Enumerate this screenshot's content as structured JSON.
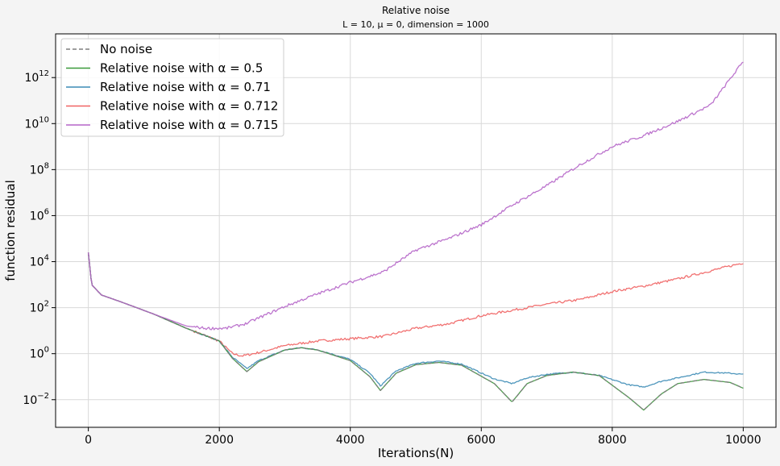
{
  "chart_data": {
    "type": "line",
    "title": "Relative noise",
    "subtitle": "L = 10, μ = 0, dimension = 1000",
    "xlabel": "Iterations(N)",
    "ylabel": "function residual",
    "xlim": [
      -500,
      10500
    ],
    "ylim_log10": [
      -3.2,
      13.9
    ],
    "yscale": "log",
    "xticks": [
      0,
      2000,
      4000,
      6000,
      8000,
      10000
    ],
    "xtick_labels": [
      "0",
      "2000",
      "4000",
      "6000",
      "8000",
      "10000"
    ],
    "yticks": [
      -2,
      0,
      2,
      4,
      6,
      8,
      10,
      12
    ],
    "ytick_labels": [
      "10",
      "10",
      "10",
      "10",
      "10",
      "10",
      "10",
      "10"
    ],
    "ytick_exponents": [
      "−2",
      "0",
      "2",
      "4",
      "6",
      "8",
      "10",
      "12"
    ],
    "grid": true,
    "legend_position": "upper-left",
    "series": [
      {
        "name": "No noise",
        "color": "#7f7f7f",
        "dash": "dashed",
        "points": [
          [
            0,
            4.4
          ],
          [
            50,
            3.0
          ],
          [
            200,
            2.55
          ],
          [
            500,
            2.25
          ],
          [
            1000,
            1.72
          ],
          [
            1500,
            1.1
          ],
          [
            2000,
            0.55
          ],
          [
            2200,
            -0.2
          ],
          [
            2420,
            -0.78
          ],
          [
            2600,
            -0.35
          ],
          [
            3000,
            0.16
          ],
          [
            3250,
            0.26
          ],
          [
            3500,
            0.16
          ],
          [
            4000,
            -0.3
          ],
          [
            4300,
            -1.0
          ],
          [
            4460,
            -1.6
          ],
          [
            4700,
            -0.85
          ],
          [
            5000,
            -0.48
          ],
          [
            5350,
            -0.38
          ],
          [
            5700,
            -0.5
          ],
          [
            6200,
            -1.3
          ],
          [
            6470,
            -2.1
          ],
          [
            6700,
            -1.3
          ],
          [
            7000,
            -0.95
          ],
          [
            7400,
            -0.8
          ],
          [
            7800,
            -0.95
          ],
          [
            8250,
            -1.9
          ],
          [
            8480,
            -2.45
          ],
          [
            8750,
            -1.75
          ],
          [
            9000,
            -1.3
          ],
          [
            9400,
            -1.12
          ],
          [
            9800,
            -1.25
          ],
          [
            10000,
            -1.5
          ]
        ]
      },
      {
        "name": "Relative noise with α = 0.5",
        "color": "#3a9a3a",
        "dash": "solid",
        "points": [
          [
            0,
            4.4
          ],
          [
            50,
            3.0
          ],
          [
            200,
            2.55
          ],
          [
            500,
            2.25
          ],
          [
            1000,
            1.72
          ],
          [
            1500,
            1.1
          ],
          [
            2000,
            0.55
          ],
          [
            2200,
            -0.2
          ],
          [
            2420,
            -0.78
          ],
          [
            2600,
            -0.35
          ],
          [
            3000,
            0.16
          ],
          [
            3250,
            0.26
          ],
          [
            3500,
            0.16
          ],
          [
            4000,
            -0.3
          ],
          [
            4300,
            -1.0
          ],
          [
            4460,
            -1.6
          ],
          [
            4700,
            -0.85
          ],
          [
            5000,
            -0.48
          ],
          [
            5350,
            -0.38
          ],
          [
            5700,
            -0.5
          ],
          [
            6200,
            -1.3
          ],
          [
            6470,
            -2.1
          ],
          [
            6700,
            -1.3
          ],
          [
            7000,
            -0.95
          ],
          [
            7400,
            -0.8
          ],
          [
            7800,
            -0.95
          ],
          [
            8250,
            -1.9
          ],
          [
            8480,
            -2.45
          ],
          [
            8750,
            -1.75
          ],
          [
            9000,
            -1.3
          ],
          [
            9400,
            -1.12
          ],
          [
            9800,
            -1.25
          ],
          [
            10000,
            -1.5
          ]
        ]
      },
      {
        "name": "Relative noise with α = 0.71",
        "color": "#3b8bb5",
        "dash": "solid",
        "points": [
          [
            0,
            4.4
          ],
          [
            50,
            3.0
          ],
          [
            200,
            2.55
          ],
          [
            500,
            2.25
          ],
          [
            1000,
            1.72
          ],
          [
            1500,
            1.1
          ],
          [
            2000,
            0.55
          ],
          [
            2200,
            -0.15
          ],
          [
            2420,
            -0.65
          ],
          [
            2600,
            -0.3
          ],
          [
            3000,
            0.16
          ],
          [
            3250,
            0.26
          ],
          [
            3500,
            0.17
          ],
          [
            4000,
            -0.25
          ],
          [
            4300,
            -0.85
          ],
          [
            4460,
            -1.4
          ],
          [
            4700,
            -0.75
          ],
          [
            5000,
            -0.42
          ],
          [
            5350,
            -0.32
          ],
          [
            5700,
            -0.45
          ],
          [
            6200,
            -1.1
          ],
          [
            6470,
            -1.3
          ],
          [
            6700,
            -1.05
          ],
          [
            7000,
            -0.9
          ],
          [
            7400,
            -0.8
          ],
          [
            7800,
            -0.95
          ],
          [
            8250,
            -1.35
          ],
          [
            8480,
            -1.45
          ],
          [
            8750,
            -1.2
          ],
          [
            9000,
            -1.05
          ],
          [
            9400,
            -0.8
          ],
          [
            9800,
            -0.85
          ],
          [
            10000,
            -0.9
          ]
        ]
      },
      {
        "name": "Relative noise with α = 0.712",
        "color": "#f06262",
        "dash": "solid",
        "points": [
          [
            0,
            4.4
          ],
          [
            50,
            3.0
          ],
          [
            200,
            2.55
          ],
          [
            500,
            2.25
          ],
          [
            1000,
            1.72
          ],
          [
            1500,
            1.1
          ],
          [
            2000,
            0.55
          ],
          [
            2200,
            0.0
          ],
          [
            2350,
            -0.1
          ],
          [
            2600,
            0.05
          ],
          [
            3000,
            0.35
          ],
          [
            3500,
            0.55
          ],
          [
            4000,
            0.65
          ],
          [
            4500,
            0.75
          ],
          [
            5000,
            1.1
          ],
          [
            5500,
            1.3
          ],
          [
            6000,
            1.65
          ],
          [
            6500,
            1.9
          ],
          [
            7000,
            2.15
          ],
          [
            7500,
            2.35
          ],
          [
            8000,
            2.7
          ],
          [
            8500,
            2.95
          ],
          [
            9000,
            3.25
          ],
          [
            9500,
            3.6
          ],
          [
            10000,
            3.95
          ]
        ]
      },
      {
        "name": "Relative noise with α = 0.715",
        "color": "#b565c8",
        "dash": "solid",
        "points": [
          [
            0,
            4.4
          ],
          [
            50,
            3.0
          ],
          [
            200,
            2.55
          ],
          [
            500,
            2.25
          ],
          [
            1000,
            1.72
          ],
          [
            1500,
            1.2
          ],
          [
            1800,
            1.1
          ],
          [
            2100,
            1.1
          ],
          [
            2400,
            1.3
          ],
          [
            3000,
            2.05
          ],
          [
            3500,
            2.6
          ],
          [
            4000,
            3.1
          ],
          [
            4500,
            3.55
          ],
          [
            5000,
            4.5
          ],
          [
            5500,
            5.0
          ],
          [
            6000,
            5.6
          ],
          [
            6500,
            6.5
          ],
          [
            7000,
            7.3
          ],
          [
            7500,
            8.2
          ],
          [
            8000,
            9.0
          ],
          [
            8500,
            9.5
          ],
          [
            9000,
            10.1
          ],
          [
            9500,
            10.8
          ],
          [
            10000,
            12.7
          ]
        ]
      }
    ]
  }
}
